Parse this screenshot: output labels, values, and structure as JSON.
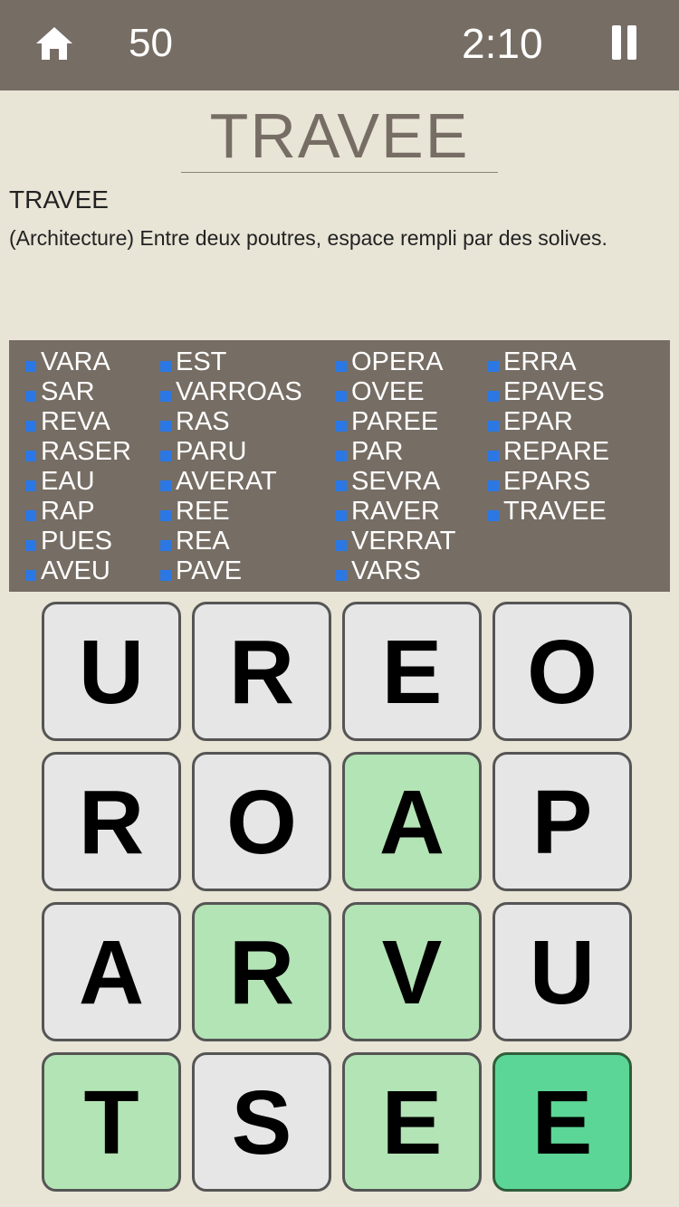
{
  "header": {
    "score": "50",
    "timer": "2:10"
  },
  "current_word": "TRAVEE",
  "definition": {
    "word": "TRAVEE",
    "text": "(Architecture) Entre deux poutres, espace rempli par des solives."
  },
  "found_words": [
    [
      "VARA",
      "SAR",
      "REVA",
      "RASER",
      "EAU",
      "RAP",
      "PUES",
      "AVEU"
    ],
    [
      "EST",
      "VARROAS",
      "RAS",
      "PARU",
      "AVERAT",
      "REE",
      "REA",
      "PAVE"
    ],
    [
      "OPERA",
      "OVEE",
      "PAREE",
      "PAR",
      "SEVRA",
      "RAVER",
      "VERRAT",
      "VARS"
    ],
    [
      "ERRA",
      "EPAVES",
      "EPAR",
      "REPARE",
      "EPARS",
      "TRAVEE"
    ]
  ],
  "grid": [
    [
      {
        "letter": "U",
        "state": "normal"
      },
      {
        "letter": "R",
        "state": "normal"
      },
      {
        "letter": "E",
        "state": "normal"
      },
      {
        "letter": "O",
        "state": "normal"
      }
    ],
    [
      {
        "letter": "R",
        "state": "normal"
      },
      {
        "letter": "O",
        "state": "normal"
      },
      {
        "letter": "A",
        "state": "selected"
      },
      {
        "letter": "P",
        "state": "normal"
      }
    ],
    [
      {
        "letter": "A",
        "state": "normal"
      },
      {
        "letter": "R",
        "state": "selected"
      },
      {
        "letter": "V",
        "state": "selected"
      },
      {
        "letter": "U",
        "state": "normal"
      }
    ],
    [
      {
        "letter": "T",
        "state": "selected"
      },
      {
        "letter": "S",
        "state": "normal"
      },
      {
        "letter": "E",
        "state": "selected"
      },
      {
        "letter": "E",
        "state": "current"
      }
    ]
  ],
  "colors": {
    "bar": "#766d64",
    "background": "#e8e4d6",
    "tile": "#e6e6e6",
    "tile_selected": "#b3e4b5",
    "tile_current": "#5cd696",
    "word_bullet": "#2b78e4"
  },
  "icons": {
    "home": "home-icon",
    "pause": "pause-icon"
  }
}
